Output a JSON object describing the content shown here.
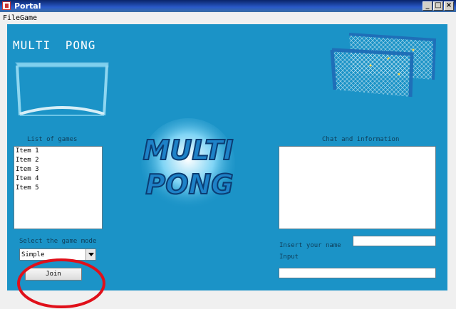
{
  "window": {
    "title": "Portal",
    "minimize_icon": "_",
    "maximize_icon": "□",
    "close_icon": "×"
  },
  "menu": {
    "file": "File",
    "game": "Game"
  },
  "app_title": "MULTI PONG",
  "logo": {
    "line1": "MULTI",
    "line2": "PONG"
  },
  "games": {
    "label": "List of games",
    "items": [
      "Item 1",
      "Item 2",
      "Item 3",
      "Item 4",
      "Item 5"
    ]
  },
  "mode": {
    "label": "Select the game mode",
    "selected": "Simple"
  },
  "join_label": "Join",
  "chat": {
    "label": "Chat and information"
  },
  "name": {
    "label": "Insert your name"
  },
  "input": {
    "label": "Input"
  },
  "colors": {
    "panel_background": "#1b93c7",
    "annotation_circle": "#e0101a"
  }
}
